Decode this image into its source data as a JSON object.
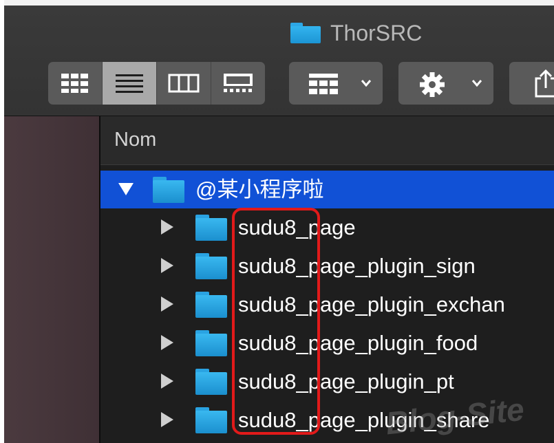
{
  "window": {
    "title": "ThorSRC"
  },
  "toolbar": {
    "view_modes": [
      "icon-view-icon",
      "list-view-icon",
      "column-view-icon",
      "gallery-view-icon"
    ],
    "active_view": "list-view-icon",
    "group_button_icon": "group-grid-icon",
    "action_button_icon": "gear-icon",
    "share_button_icon": "share-icon"
  },
  "columns": {
    "name": "Nom"
  },
  "tree": {
    "parent": {
      "label": "@某小程序啦",
      "expanded": true,
      "selected": true
    },
    "children": [
      {
        "label": "sudu8_page"
      },
      {
        "label": "sudu8_page_plugin_sign"
      },
      {
        "label": "sudu8_page_plugin_exchan"
      },
      {
        "label": "sudu8_page_plugin_food"
      },
      {
        "label": "sudu8_page_plugin_pt"
      },
      {
        "label": "sudu8_page_plugin_share"
      }
    ]
  },
  "annotation": {
    "color": "#e21a1a"
  },
  "watermark": {
    "text": "Blog-Site"
  },
  "colors": {
    "selection": "#1151d6",
    "folder": "#2aa3e2",
    "sidebar": "#4b3a3f"
  }
}
